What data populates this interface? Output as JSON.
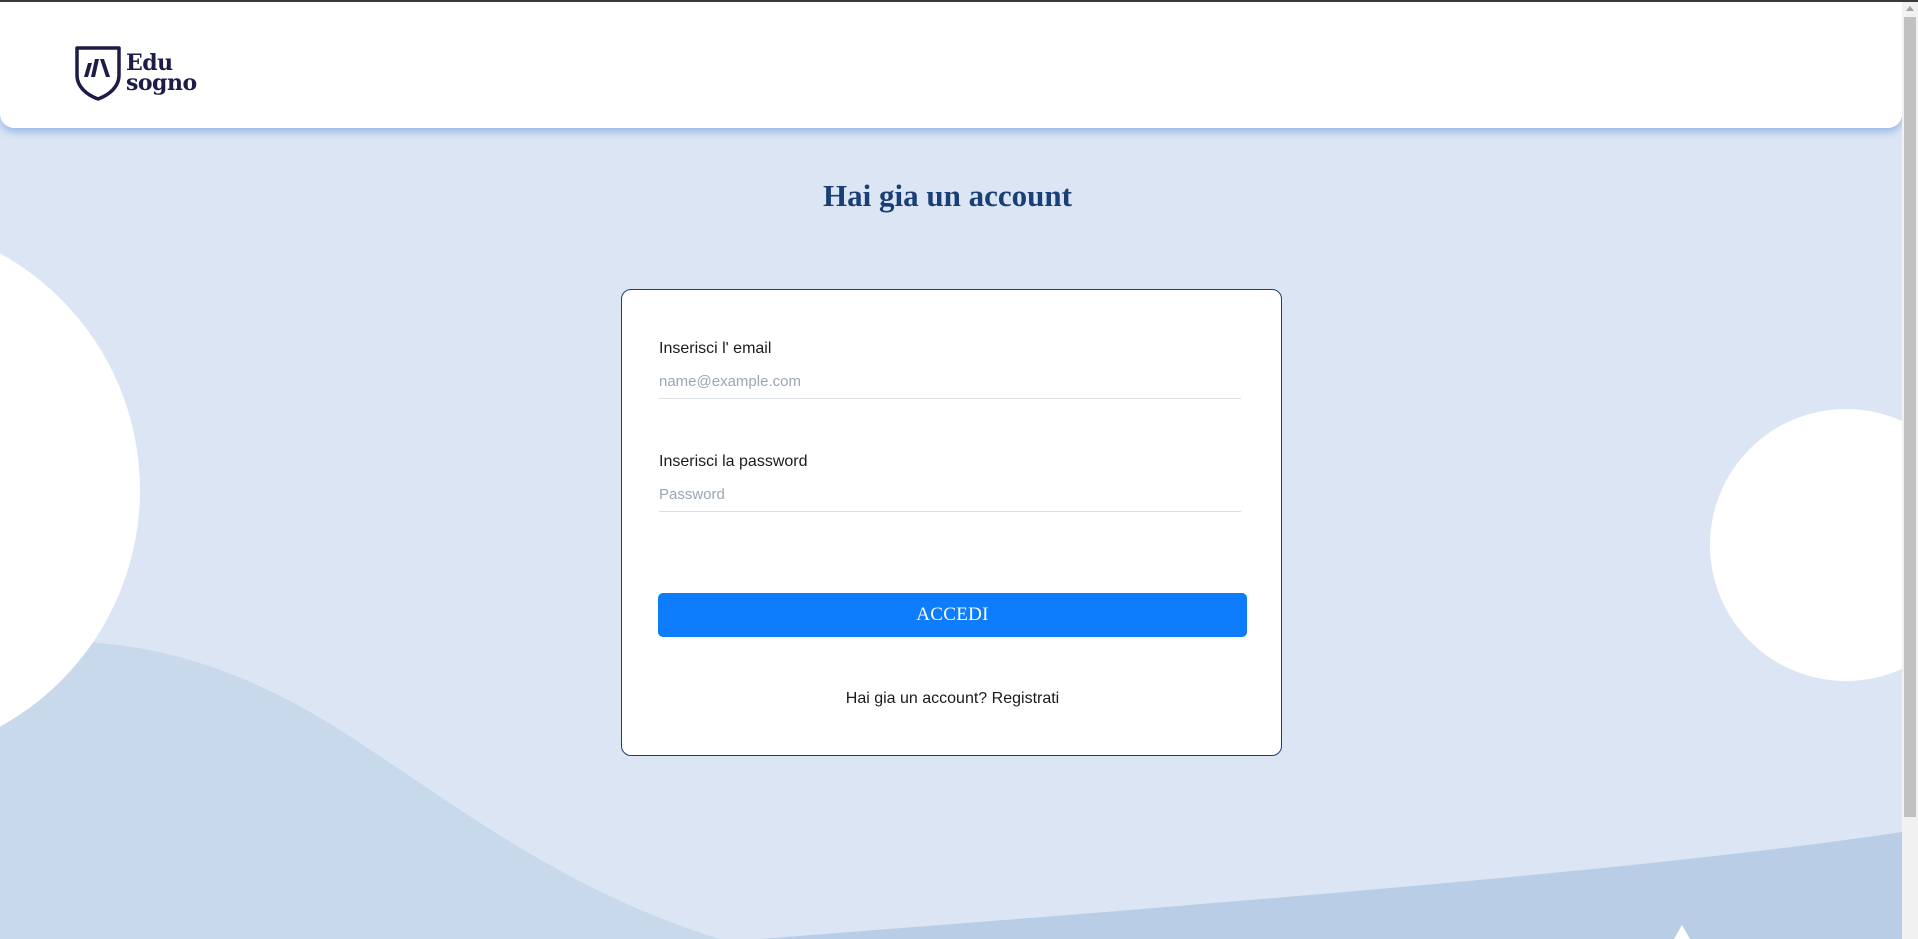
{
  "brand": {
    "name_line1": "Edu",
    "name_line2": "sogno",
    "logo_icon": "shield-books-icon",
    "color": "#1d1b47"
  },
  "page": {
    "title": "Hai gia un account"
  },
  "login_form": {
    "email_label": "Inserisci l' email",
    "email_placeholder": "name@example.com",
    "email_value": "",
    "password_label": "Inserisci la password",
    "password_placeholder": "Password",
    "password_value": "",
    "submit_label": "ACCEDI",
    "register_prompt": "Hai gia un account?",
    "register_link": "Registrati"
  },
  "colors": {
    "background": "#dbe5f3",
    "wave": "#c9d9ec",
    "title": "#1a3f77",
    "button": "#0d7cfd",
    "card_border": "#1f3f6e"
  }
}
